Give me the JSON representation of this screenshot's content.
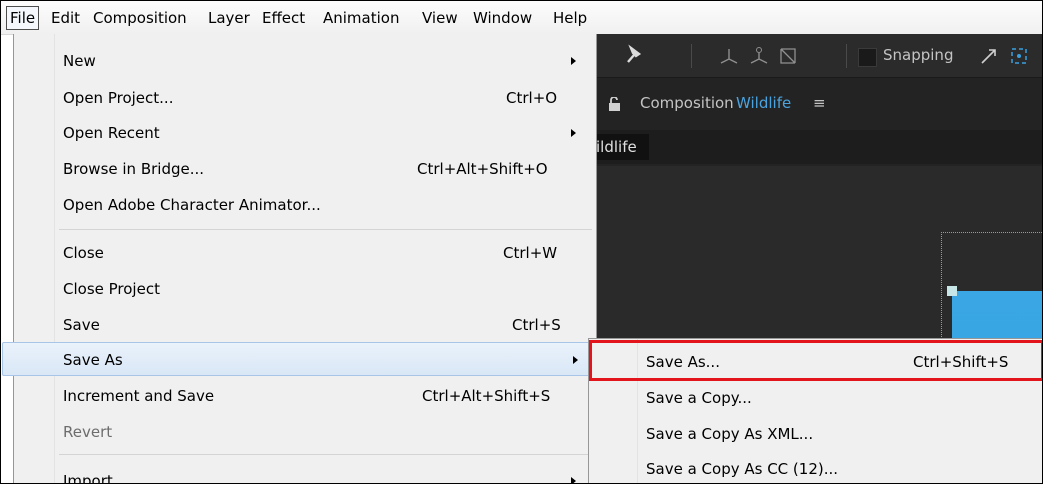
{
  "menubar": {
    "items": [
      "File",
      "Edit",
      "Composition",
      "Layer",
      "Effect",
      "Animation",
      "View",
      "Window",
      "Help"
    ]
  },
  "toolbar": {
    "pin_icon": "pin-icon",
    "snapping_label": "Snapping"
  },
  "panel": {
    "lock_icon": "lock-icon",
    "title_prefix": "Composition",
    "comp_name": "Wildlife",
    "menu_icon": "≡",
    "tab_label": "ildlife"
  },
  "file_menu": {
    "items": [
      {
        "label": "New",
        "shortcut": "",
        "submenu": true
      },
      {
        "label": "Open Project...",
        "shortcut": "Ctrl+O",
        "submenu": false
      },
      {
        "label": "Open Recent",
        "shortcut": "",
        "submenu": true
      },
      {
        "label": "Browse in Bridge...",
        "shortcut": "Ctrl+Alt+Shift+O",
        "submenu": false
      },
      {
        "label": "Open Adobe Character Animator...",
        "shortcut": "",
        "submenu": false
      },
      {
        "label": "Close",
        "shortcut": "Ctrl+W",
        "submenu": false
      },
      {
        "label": "Close Project",
        "shortcut": "",
        "submenu": false
      },
      {
        "label": "Save",
        "shortcut": "Ctrl+S",
        "submenu": false
      },
      {
        "label": "Save As",
        "shortcut": "",
        "submenu": true,
        "highlighted": true
      },
      {
        "label": "Increment and Save",
        "shortcut": "Ctrl+Alt+Shift+S",
        "submenu": false
      },
      {
        "label": "Revert",
        "shortcut": "",
        "submenu": false,
        "disabled": true
      },
      {
        "label": "Import",
        "shortcut": "",
        "submenu": true
      }
    ]
  },
  "save_as_submenu": {
    "items": [
      {
        "label": "Save As...",
        "shortcut": "Ctrl+Shift+S"
      },
      {
        "label": "Save a Copy...",
        "shortcut": ""
      },
      {
        "label": "Save a Copy As XML...",
        "shortcut": ""
      },
      {
        "label": "Save a Copy As CC (12)...",
        "shortcut": ""
      }
    ]
  },
  "colors": {
    "highlight_box": "#e4141c",
    "comp_name": "#4aa3df",
    "layer_fill": "#36a5e5"
  }
}
